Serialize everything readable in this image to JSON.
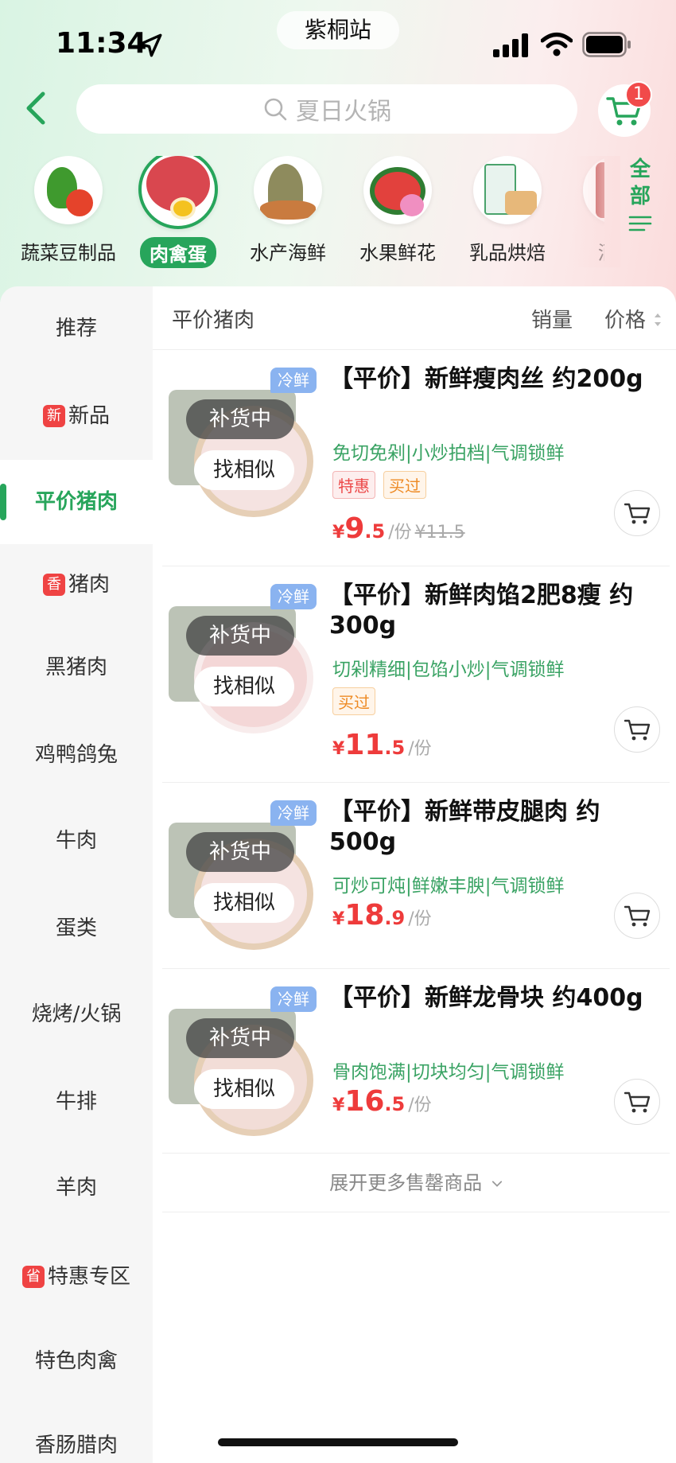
{
  "status_bar": {
    "time": "11:34",
    "station": "紫桐站"
  },
  "header": {
    "search_placeholder": "夏日火锅",
    "cart_count": "1"
  },
  "categories": [
    {
      "label": "蔬菜豆制品",
      "icon": "vegetable-icon",
      "active": false
    },
    {
      "label": "肉禽蛋",
      "icon": "meat-icon",
      "active": true
    },
    {
      "label": "水产海鲜",
      "icon": "seafood-icon",
      "active": false
    },
    {
      "label": "水果鲜花",
      "icon": "watermelon-icon",
      "active": false
    },
    {
      "label": "乳品烘焙",
      "icon": "dairy-icon",
      "active": false
    },
    {
      "label": "酒水",
      "icon": "drinks-icon",
      "active": false
    }
  ],
  "all_button": {
    "line1": "全",
    "line2": "部"
  },
  "sidebar": {
    "items": [
      {
        "label": "推荐",
        "tag": ""
      },
      {
        "label": "新品",
        "tag": "新"
      },
      {
        "label": "平价猪肉",
        "tag": ""
      },
      {
        "label": "猪肉",
        "tag": "香"
      },
      {
        "label": "黑猪肉",
        "tag": ""
      },
      {
        "label": "鸡鸭鸽兔",
        "tag": ""
      },
      {
        "label": "牛肉",
        "tag": ""
      },
      {
        "label": "蛋类",
        "tag": ""
      },
      {
        "label": "烧烤/火锅",
        "tag": ""
      },
      {
        "label": "牛排",
        "tag": ""
      },
      {
        "label": "羊肉",
        "tag": ""
      },
      {
        "label": "特惠专区",
        "tag": "省"
      },
      {
        "label": "特色肉禽",
        "tag": ""
      },
      {
        "label": "香肠腊肉",
        "tag": ""
      }
    ],
    "active_index": 2
  },
  "sort_bar": {
    "title": "平价猪肉",
    "sales": "销量",
    "price": "价格"
  },
  "products": [
    {
      "chill_tag": "冷鲜",
      "restock": "补货中",
      "similar": "找相似",
      "title": "【平价】新鲜瘦肉丝 约200g",
      "desc": "免切免剁|小炒拍档|气调锁鲜",
      "tags": [
        {
          "text": "特惠",
          "style": "red"
        },
        {
          "text": "买过",
          "style": "orange"
        }
      ],
      "currency": "¥",
      "price_int": "9",
      "price_dec": ".5",
      "unit": "/份",
      "orig_price": "¥11.5"
    },
    {
      "chill_tag": "冷鲜",
      "restock": "补货中",
      "similar": "找相似",
      "title": "【平价】新鲜肉馅2肥8瘦 约300g",
      "desc": "切剁精细|包馅小炒|气调锁鲜",
      "tags": [
        {
          "text": "买过",
          "style": "orange"
        }
      ],
      "currency": "¥",
      "price_int": "11",
      "price_dec": ".5",
      "unit": "/份",
      "orig_price": ""
    },
    {
      "chill_tag": "冷鲜",
      "restock": "补货中",
      "similar": "找相似",
      "title": "【平价】新鲜带皮腿肉 约500g",
      "desc": "可炒可炖|鲜嫩丰腴|气调锁鲜",
      "tags": [],
      "currency": "¥",
      "price_int": "18",
      "price_dec": ".9",
      "unit": "/份",
      "orig_price": ""
    },
    {
      "chill_tag": "冷鲜",
      "restock": "补货中",
      "similar": "找相似",
      "title": "【平价】新鲜龙骨块 约400g",
      "desc": "骨肉饱满|切块均匀|气调锁鲜",
      "tags": [],
      "currency": "¥",
      "price_int": "16",
      "price_dec": ".5",
      "unit": "/份",
      "orig_price": ""
    }
  ],
  "more_label": "展开更多售罄商品",
  "colors": {
    "accent": "#27a55b",
    "price": "#ee3b3b",
    "badge": "#f14a4a"
  }
}
